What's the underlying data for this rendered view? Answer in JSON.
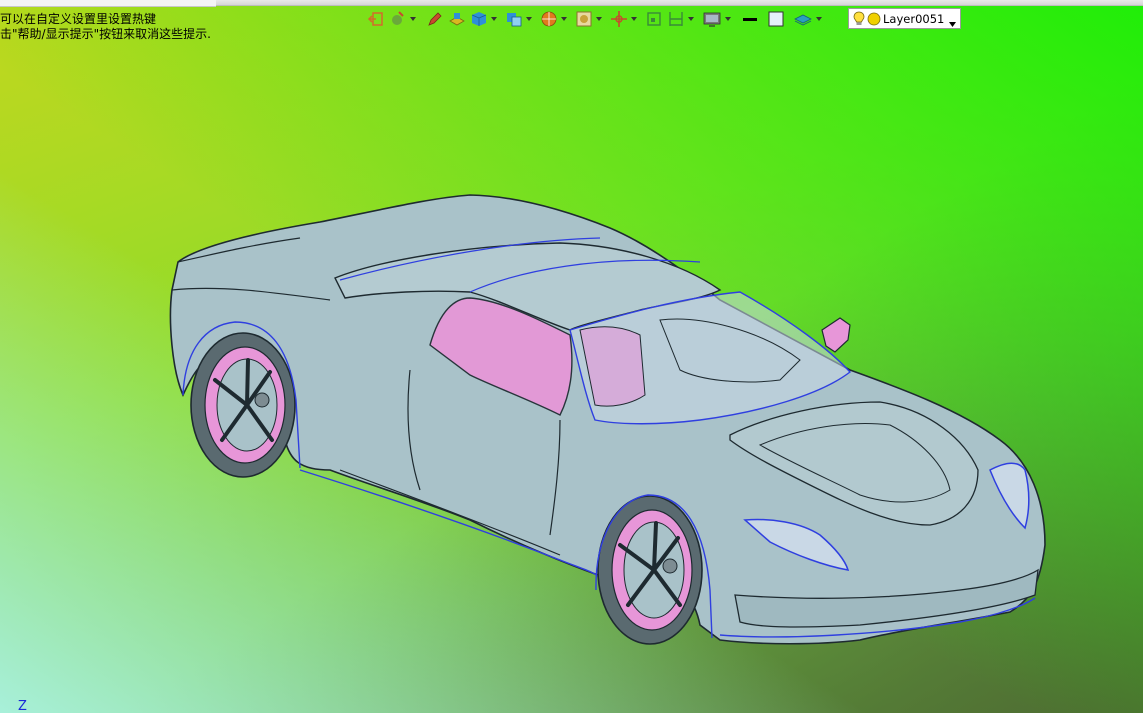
{
  "hints": {
    "line1": "可以在自定义设置里设置热键",
    "line2": "击\"帮助/显示提示\"按钮来取消这些提示."
  },
  "toolbar": {
    "buttons": [
      {
        "name": "exit-sketch-icon",
        "color": "#d46a2a"
      },
      {
        "name": "sketch-tools-icon",
        "color": "#6aa83a"
      },
      {
        "name": "pencil-icon",
        "color": "#c84a2e"
      },
      {
        "name": "extrude-icon",
        "color": "#d9b820"
      },
      {
        "name": "solid-cube-icon",
        "color": "#2f8fd8"
      },
      {
        "name": "boolean-icon",
        "color": "#2f8fd8"
      },
      {
        "name": "sphere-icon",
        "color": "#e07a1e"
      },
      {
        "name": "surface-icon",
        "color": "#c9a23a"
      },
      {
        "name": "move-icon",
        "color": "#c84a2e"
      },
      {
        "name": "snap-icon",
        "color": "#3a8a3a"
      },
      {
        "name": "align-icon",
        "color": "#3a8a3a"
      },
      {
        "name": "display-mode-icon",
        "color": "#7a7a7a"
      },
      {
        "name": "line-style-icon",
        "color": "#000000"
      },
      {
        "name": "face-color-icon",
        "color": "#ffffff"
      },
      {
        "name": "layer-plane-icon",
        "color": "#2aa0c0"
      }
    ]
  },
  "layer": {
    "current": "Layer0051",
    "bulb_color": "#ffe040",
    "dot_color": "#f0d000"
  },
  "viewport": {
    "axis_label": "Z",
    "body_color": "#a9c2c9",
    "edge_color": "#1e2a30",
    "highlight_color": "#2f3fe0",
    "interior_color": "#e796d8"
  }
}
